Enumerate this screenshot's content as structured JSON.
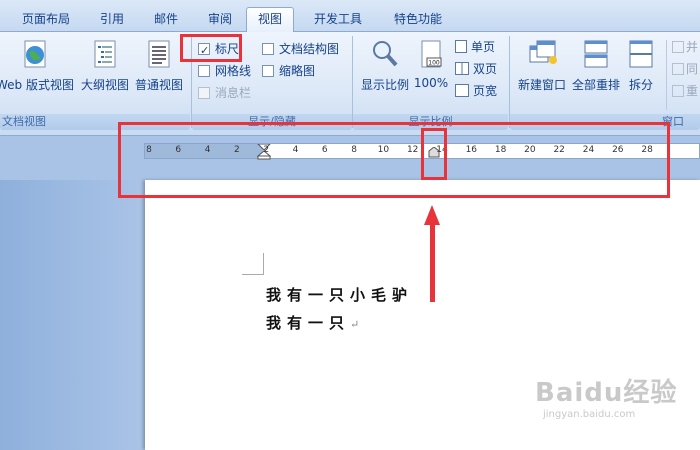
{
  "tabs": [
    {
      "label": "页面布局",
      "active": false
    },
    {
      "label": "引用",
      "active": false
    },
    {
      "label": "邮件",
      "active": false
    },
    {
      "label": "审阅",
      "active": false
    },
    {
      "label": "视图",
      "active": true
    },
    {
      "label": "开发工具",
      "active": false
    },
    {
      "label": "特色功能",
      "active": false
    }
  ],
  "doc_views": {
    "web_label": "Web 版式视图",
    "outline_label": "大纲视图",
    "draft_label": "普通视图",
    "group_label": "文档视图"
  },
  "show_hide": {
    "ruler_label": "标尺",
    "ruler_checked": true,
    "gridlines_label": "网格线",
    "gridlines_checked": false,
    "message_bar_label": "消息栏",
    "doc_map_label": "文档结构图",
    "doc_map_checked": false,
    "thumbnails_label": "缩略图",
    "thumbnails_checked": false,
    "group_label": "显示/隐藏"
  },
  "zoom": {
    "zoom_label": "显示比例",
    "percent_label": "100%",
    "one_page_label": "单页",
    "two_pages_label": "双页",
    "page_width_label": "页宽",
    "group_label": "显示比例"
  },
  "window": {
    "new_window_label": "新建窗口",
    "arrange_all_label": "全部重排",
    "split_label": "拆分",
    "side_by_side_label": "并",
    "sync_scroll_label": "同",
    "reset_position_label": "重",
    "group_label": "窗口"
  },
  "ruler": {
    "ticks": [
      "8",
      "6",
      "4",
      "2",
      "2",
      "4",
      "6",
      "8",
      "10",
      "12",
      "14",
      "16",
      "18",
      "20",
      "22",
      "24",
      "26",
      "28"
    ]
  },
  "document": {
    "line1": "我有一只小毛驴",
    "line2": "我有一只",
    "paragraph_mark": "↵"
  },
  "watermark": {
    "logo": "Baidu经验",
    "sub": "jingyan.baidu.com"
  },
  "colors": {
    "annotation_red": "#e8333a",
    "ribbon_text": "#15428b"
  }
}
